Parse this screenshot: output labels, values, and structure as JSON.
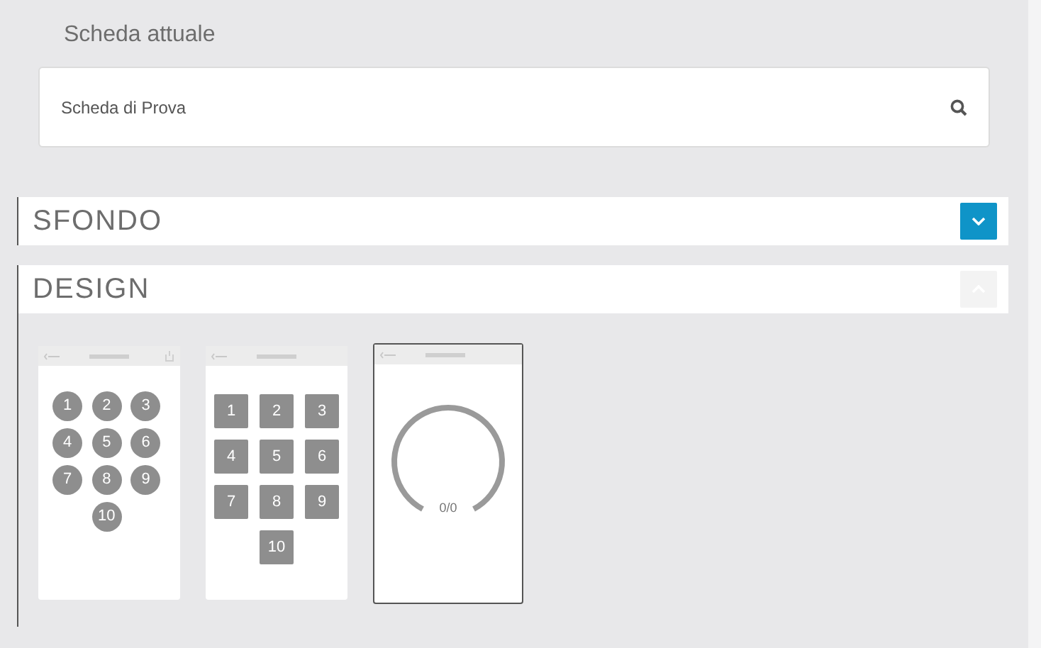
{
  "current": {
    "label": "Scheda attuale",
    "value": "Scheda di Prova"
  },
  "sections": [
    {
      "title": "SFONDO",
      "expanded": false
    },
    {
      "title": "DESIGN",
      "expanded": true,
      "designs": [
        {
          "kind": "circles",
          "selected": false,
          "keys": [
            "1",
            "2",
            "3",
            "4",
            "5",
            "6",
            "7",
            "8",
            "9",
            "10"
          ]
        },
        {
          "kind": "squares",
          "selected": false,
          "keys": [
            "1",
            "2",
            "3",
            "4",
            "5",
            "6",
            "7",
            "8",
            "9",
            "10"
          ]
        },
        {
          "kind": "gauge",
          "selected": true,
          "reading": "0/0"
        }
      ]
    }
  ]
}
